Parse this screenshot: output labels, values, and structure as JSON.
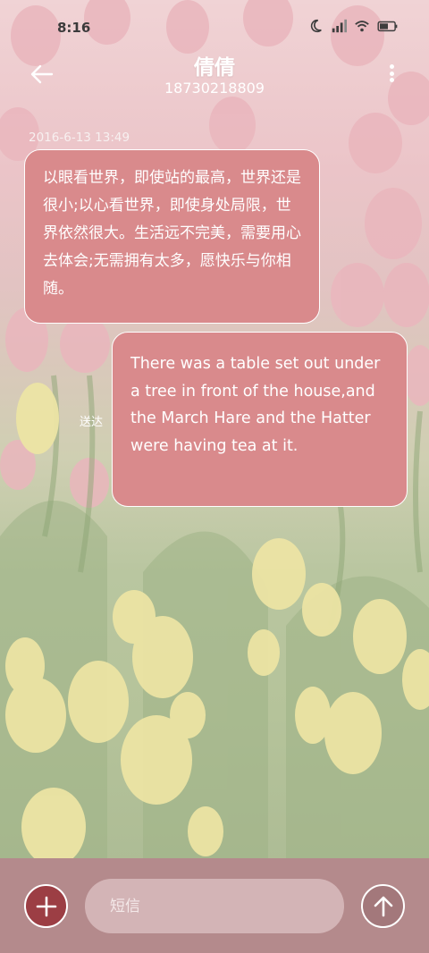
{
  "status_bar": {
    "time": "8:16",
    "icons": [
      "moon-icon",
      "signal-icon",
      "wifi-icon",
      "battery-icon"
    ]
  },
  "header": {
    "contact_name": "倩倩",
    "phone_number": "18730218809",
    "back_icon": "arrow-left-icon",
    "menu_icon": "more-vertical-icon"
  },
  "conversation": {
    "timestamp": "2016-6-13 13:49",
    "incoming_message": "以眼看世界，即使站的最高，世界还是很小;以心看世界，即使身处局限，世界依然很大。生活远不完美，需要用心去体会;无需拥有太多，愿快乐与你相随。",
    "outgoing_message": "There was a table set out under a tree in front of the house,and the March Hare and the Hatter were having tea at it.",
    "sent_status": "送达"
  },
  "composer": {
    "placeholder": "短信",
    "add_icon": "plus-icon",
    "send_icon": "arrow-up-icon"
  },
  "colors": {
    "bubble": "#d98a8c",
    "bubble_border": "#ffffff",
    "bottom_bar": "#b48a8c",
    "add_button": "#9c3e44",
    "input": "#d3b4b6"
  }
}
